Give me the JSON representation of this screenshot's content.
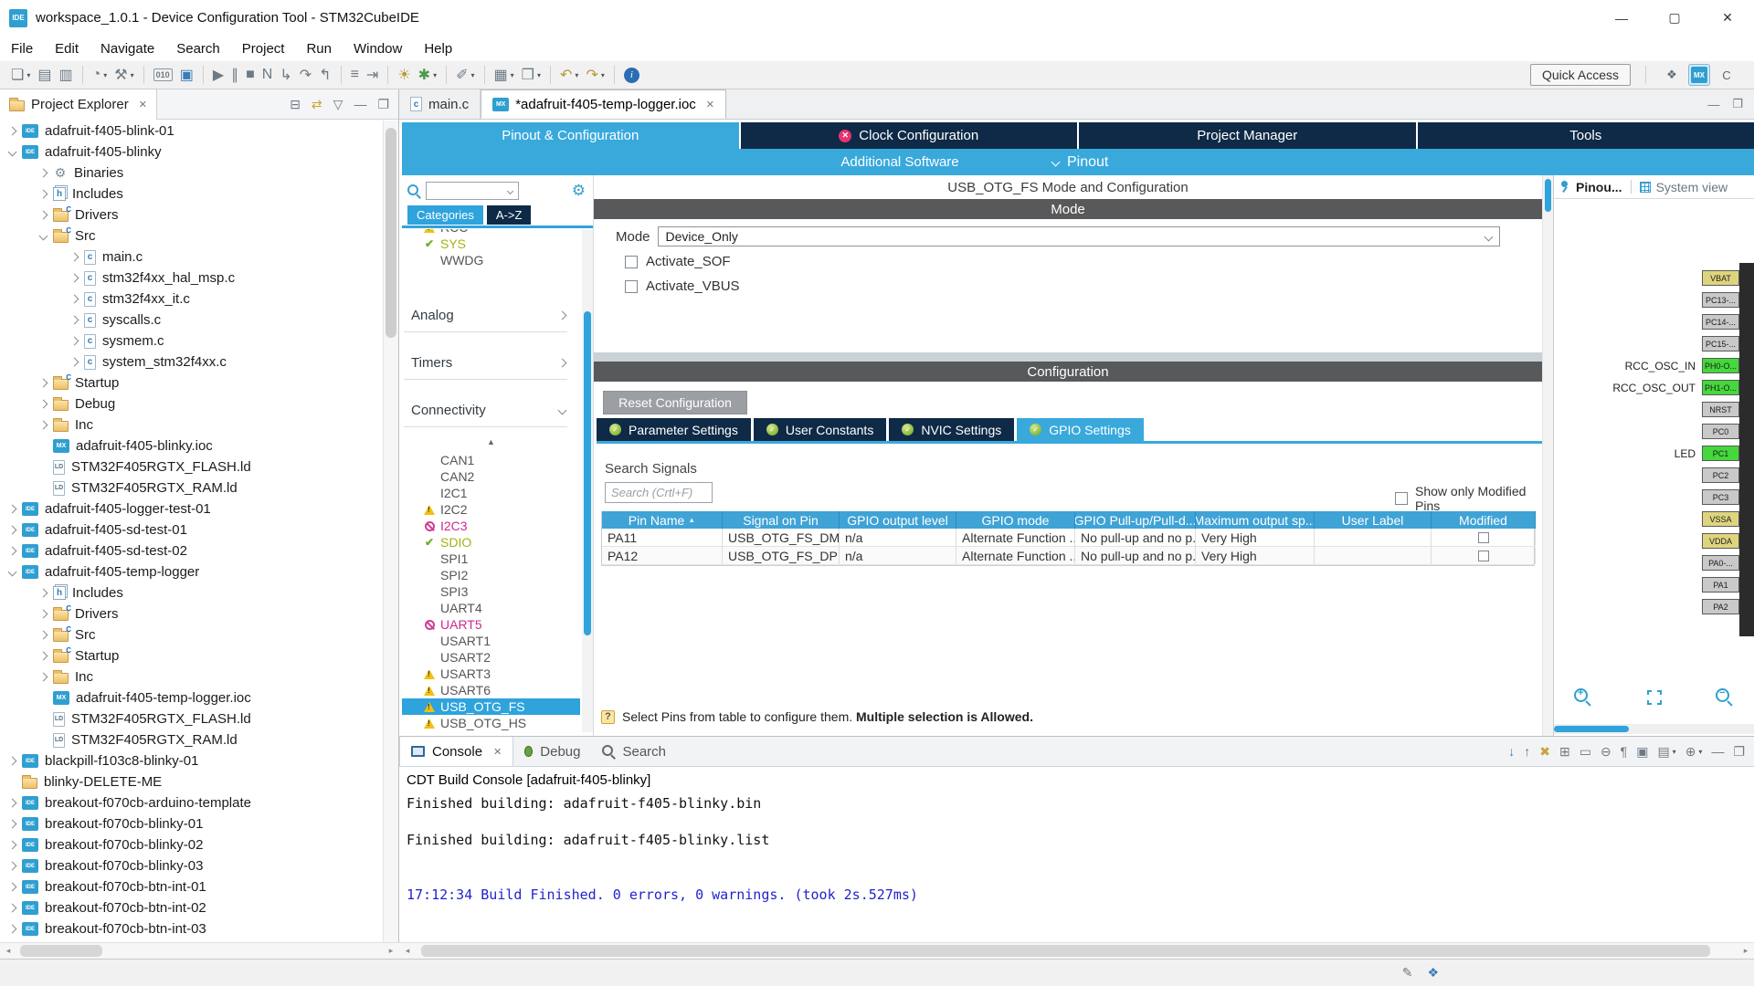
{
  "window": {
    "title": "workspace_1.0.1 - Device Configuration Tool - STM32CubeIDE",
    "app_badge": "IDE",
    "minimize": "—",
    "maximize": "▢",
    "close": "✕"
  },
  "menubar": [
    "File",
    "Edit",
    "Navigate",
    "Search",
    "Project",
    "Run",
    "Window",
    "Help"
  ],
  "toolbar": {
    "quick_access_label": "Quick Access",
    "items": [
      {
        "name": "new-icon",
        "glyph": "❏",
        "dropdown": true
      },
      {
        "name": "save-icon",
        "glyph": "▤"
      },
      {
        "name": "save-all-icon",
        "glyph": "▥"
      },
      {
        "sep": true
      },
      {
        "name": "launch-config-icon",
        "glyph": "◔",
        "dropdown": true
      },
      {
        "name": "build-icon",
        "glyph": "⚒",
        "dropdown": true
      },
      {
        "sep": true
      },
      {
        "name": "binary-icon",
        "glyph": "010",
        "text": true
      },
      {
        "name": "open-console-icon",
        "glyph": "▣",
        "color": "#3a7db8"
      },
      {
        "sep": true
      },
      {
        "name": "resume-icon",
        "glyph": "▶"
      },
      {
        "name": "suspend-icon",
        "glyph": "∥"
      },
      {
        "name": "terminate-icon",
        "glyph": "■"
      },
      {
        "name": "disconnect-icon",
        "glyph": "N"
      },
      {
        "name": "step-into-icon",
        "glyph": "↳"
      },
      {
        "name": "step-over-icon",
        "glyph": "↷"
      },
      {
        "name": "step-return-icon",
        "glyph": "↰"
      },
      {
        "sep": true
      },
      {
        "name": "instruction-stepping-icon",
        "glyph": "≡"
      },
      {
        "name": "skip-breakpoints-icon",
        "glyph": "⇥"
      },
      {
        "sep": true
      },
      {
        "name": "debug-icon",
        "glyph": "☀",
        "color": "#b49a35"
      },
      {
        "name": "run-icon",
        "glyph": "✱",
        "color": "#4c9a4c",
        "dropdown": true
      },
      {
        "sep": true
      },
      {
        "name": "profile-icon",
        "glyph": "✐",
        "dropdown": true
      },
      {
        "sep": true
      },
      {
        "name": "coverage-icon",
        "glyph": "▦",
        "dropdown": true
      },
      {
        "name": "new-cfile-icon",
        "glyph": "❒",
        "dropdown": true
      },
      {
        "sep": true
      },
      {
        "name": "back-icon",
        "glyph": "↶",
        "color": "#b49a35",
        "dropdown": true
      },
      {
        "name": "forward-icon",
        "glyph": "↷",
        "color": "#b49a35",
        "dropdown": true
      },
      {
        "sep": true
      },
      {
        "name": "info-icon",
        "glyph": "i",
        "info": true
      }
    ],
    "perspectives": [
      {
        "name": "open-perspective-icon",
        "glyph": "❖"
      },
      {
        "name": "device-configuration-perspective-icon",
        "glyph": "MX",
        "active": true
      },
      {
        "name": "c-cpp-perspective-icon",
        "glyph": "C"
      }
    ]
  },
  "project_explorer": {
    "title": "Project Explorer",
    "actions": [
      {
        "name": "collapse-all-icon",
        "glyph": "⊟"
      },
      {
        "name": "link-with-editor-icon",
        "glyph": "⇄",
        "color": "#c9a227"
      },
      {
        "name": "view-menu-icon",
        "glyph": "▽"
      },
      {
        "name": "minimize-view-icon",
        "glyph": "—"
      },
      {
        "name": "maximize-view-icon",
        "glyph": "❐"
      }
    ],
    "items": [
      {
        "label": "adafruit-f405-blink-01",
        "depth": 0,
        "icon": "ide",
        "expand": "closed"
      },
      {
        "label": "adafruit-f405-blinky",
        "depth": 0,
        "icon": "ide",
        "expand": "open"
      },
      {
        "label": "Binaries",
        "depth": 1,
        "icon": "bin",
        "expand": "closed"
      },
      {
        "label": "Includes",
        "depth": 1,
        "icon": "inc",
        "expand": "closed"
      },
      {
        "label": "Drivers",
        "depth": 1,
        "icon": "folderc",
        "expand": "closed"
      },
      {
        "label": "Src",
        "depth": 1,
        "icon": "folderc",
        "expand": "open"
      },
      {
        "label": "main.c",
        "depth": 2,
        "icon": "cfile",
        "expand": "closed"
      },
      {
        "label": "stm32f4xx_hal_msp.c",
        "depth": 2,
        "icon": "cfile",
        "expand": "closed"
      },
      {
        "label": "stm32f4xx_it.c",
        "depth": 2,
        "icon": "cfile",
        "expand": "closed"
      },
      {
        "label": "syscalls.c",
        "depth": 2,
        "icon": "cfile",
        "expand": "closed"
      },
      {
        "label": "sysmem.c",
        "depth": 2,
        "icon": "cfile",
        "expand": "closed"
      },
      {
        "label": "system_stm32f4xx.c",
        "depth": 2,
        "icon": "cfile",
        "expand": "closed"
      },
      {
        "label": "Startup",
        "depth": 1,
        "icon": "folderc",
        "expand": "closed"
      },
      {
        "label": "Debug",
        "depth": 1,
        "icon": "folder",
        "expand": "closed"
      },
      {
        "label": "Inc",
        "depth": 1,
        "icon": "folder",
        "expand": "closed"
      },
      {
        "label": "adafruit-f405-blinky.ioc",
        "depth": 1,
        "icon": "mx",
        "expand": null
      },
      {
        "label": "STM32F405RGTX_FLASH.ld",
        "depth": 1,
        "icon": "ld",
        "expand": null
      },
      {
        "label": "STM32F405RGTX_RAM.ld",
        "depth": 1,
        "icon": "ld",
        "expand": null
      },
      {
        "label": "adafruit-f405-logger-test-01",
        "depth": 0,
        "icon": "ide",
        "expand": "closed"
      },
      {
        "label": "adafruit-f405-sd-test-01",
        "depth": 0,
        "icon": "ide",
        "expand": "closed"
      },
      {
        "label": "adafruit-f405-sd-test-02",
        "depth": 0,
        "icon": "ide",
        "expand": "closed"
      },
      {
        "label": "adafruit-f405-temp-logger",
        "depth": 0,
        "icon": "ide",
        "expand": "open"
      },
      {
        "label": "Includes",
        "depth": 1,
        "icon": "inc",
        "expand": "closed"
      },
      {
        "label": "Drivers",
        "depth": 1,
        "icon": "folderc",
        "expand": "closed"
      },
      {
        "label": "Src",
        "depth": 1,
        "icon": "folderc",
        "expand": "closed"
      },
      {
        "label": "Startup",
        "depth": 1,
        "icon": "folderc",
        "expand": "closed"
      },
      {
        "label": "Inc",
        "depth": 1,
        "icon": "folder",
        "expand": "closed"
      },
      {
        "label": "adafruit-f405-temp-logger.ioc",
        "depth": 1,
        "icon": "mx",
        "expand": null
      },
      {
        "label": "STM32F405RGTX_FLASH.ld",
        "depth": 1,
        "icon": "ld",
        "expand": null
      },
      {
        "label": "STM32F405RGTX_RAM.ld",
        "depth": 1,
        "icon": "ld",
        "expand": null
      },
      {
        "label": "blackpill-f103c8-blinky-01",
        "depth": 0,
        "icon": "ide",
        "expand": "closed"
      },
      {
        "label": "blinky-DELETE-ME",
        "depth": 0,
        "icon": "folder",
        "expand": null
      },
      {
        "label": "breakout-f070cb-arduino-template",
        "depth": 0,
        "icon": "ide",
        "expand": "closed"
      },
      {
        "label": "breakout-f070cb-blinky-01",
        "depth": 0,
        "icon": "ide",
        "expand": "closed"
      },
      {
        "label": "breakout-f070cb-blinky-02",
        "depth": 0,
        "icon": "ide",
        "expand": "closed"
      },
      {
        "label": "breakout-f070cb-blinky-03",
        "depth": 0,
        "icon": "ide",
        "expand": "closed"
      },
      {
        "label": "breakout-f070cb-btn-int-01",
        "depth": 0,
        "icon": "ide",
        "expand": "closed"
      },
      {
        "label": "breakout-f070cb-btn-int-02",
        "depth": 0,
        "icon": "ide",
        "expand": "closed"
      },
      {
        "label": "breakout-f070cb-btn-int-03",
        "depth": 0,
        "icon": "ide",
        "expand": "closed"
      }
    ]
  },
  "editor": {
    "tabs": [
      {
        "label": "main.c",
        "icon": "cfile",
        "active": false
      },
      {
        "label": "*adafruit-f405-temp-logger.ioc",
        "icon": "mx",
        "active": true,
        "close": "✕"
      }
    ],
    "config_tabs": [
      {
        "label": "Pinout & Configuration",
        "active": true
      },
      {
        "label": "Clock Configuration",
        "error": true
      },
      {
        "label": "Project Manager"
      },
      {
        "label": "Tools"
      }
    ],
    "subnav": {
      "additional_software": "Additional Software",
      "pinout": "Pinout"
    }
  },
  "peripherals": {
    "tabs": [
      {
        "label": "Categories",
        "active": true
      },
      {
        "label": "A->Z"
      }
    ],
    "top_items": [
      {
        "label": "RCC",
        "icon": "warning",
        "partial": true
      },
      {
        "label": "SYS",
        "icon": "check",
        "style": "olive"
      },
      {
        "label": "WWDG"
      }
    ],
    "groups": [
      {
        "label": "Analog",
        "state": "collapsed"
      },
      {
        "label": "Timers",
        "state": "collapsed"
      },
      {
        "label": "Connectivity",
        "state": "expanded"
      }
    ],
    "connectivity_items": [
      {
        "label": "CAN1"
      },
      {
        "label": "CAN2"
      },
      {
        "label": "I2C1"
      },
      {
        "label": "I2C2",
        "icon": "warning"
      },
      {
        "label": "I2C3",
        "icon": "block",
        "style": "magenta"
      },
      {
        "label": "SDIO",
        "icon": "check",
        "style": "olive"
      },
      {
        "label": "SPI1"
      },
      {
        "label": "SPI2"
      },
      {
        "label": "SPI3"
      },
      {
        "label": "UART4"
      },
      {
        "label": "UART5",
        "icon": "block",
        "style": "magenta"
      },
      {
        "label": "USART1"
      },
      {
        "label": "USART2"
      },
      {
        "label": "USART3",
        "icon": "warning"
      },
      {
        "label": "USART6",
        "icon": "warning"
      },
      {
        "label": "USB_OTG_FS",
        "icon": "warning",
        "selected": true
      },
      {
        "label": "USB_OTG_HS",
        "icon": "warning"
      }
    ]
  },
  "mode_panel": {
    "title": "USB_OTG_FS Mode and Configuration",
    "section": "Mode",
    "mode_label": "Mode",
    "mode_value": "Device_Only",
    "checkboxes": [
      {
        "label": "Activate_SOF",
        "checked": false
      },
      {
        "label": "Activate_VBUS",
        "checked": false
      }
    ]
  },
  "configuration": {
    "section": "Configuration",
    "reset_button": "Reset Configuration",
    "tabs": [
      {
        "label": "Parameter Settings"
      },
      {
        "label": "User Constants"
      },
      {
        "label": "NVIC Settings"
      },
      {
        "label": "GPIO Settings",
        "active": true
      }
    ],
    "search_label": "Search Signals",
    "search_placeholder": "Search (Crtl+F)",
    "show_modified_label": "Show only Modified Pins",
    "table": {
      "columns": [
        "Pin Name",
        "Signal on Pin",
        "GPIO output level",
        "GPIO mode",
        "GPIO Pull-up/Pull-d...",
        "Maximum output sp...",
        "User Label",
        "Modified"
      ],
      "sorted_column": 0,
      "rows": [
        [
          "PA11",
          "USB_OTG_FS_DM",
          "n/a",
          "Alternate Function ...",
          "No pull-up and no p...",
          "Very High",
          "",
          false
        ],
        [
          "PA12",
          "USB_OTG_FS_DP",
          "n/a",
          "Alternate Function ...",
          "No pull-up and no p...",
          "Very High",
          "",
          false
        ]
      ]
    },
    "hint_text": "Select Pins from table to configure them. ",
    "hint_bold": "Multiple selection is Allowed."
  },
  "pinout_panel": {
    "tabs": [
      {
        "label": "Pinou...",
        "active": true
      },
      {
        "label": "System view"
      }
    ],
    "net_labels": [
      {
        "text": "RCC_OSC_IN",
        "pin_index": 4
      },
      {
        "text": "RCC_OSC_OUT",
        "pin_index": 5
      },
      {
        "text": "LED",
        "pin_index": 8
      }
    ],
    "pins": [
      {
        "label": "VBAT",
        "color": "#ded47e"
      },
      {
        "label": "PC13-...",
        "color": "#c9c9c9"
      },
      {
        "label": "PC14-...",
        "color": "#c9c9c9"
      },
      {
        "label": "PC15-...",
        "color": "#c9c9c9"
      },
      {
        "label": "PH0-O...",
        "color": "#45d83c"
      },
      {
        "label": "PH1-O...",
        "color": "#45d83c"
      },
      {
        "label": "NRST",
        "color": "#c9c9c9"
      },
      {
        "label": "PC0",
        "color": "#c9c9c9"
      },
      {
        "label": "PC1",
        "color": "#45d83c"
      },
      {
        "label": "PC2",
        "color": "#c9c9c9"
      },
      {
        "label": "PC3",
        "color": "#c9c9c9"
      },
      {
        "label": "VSSA",
        "color": "#ded47e"
      },
      {
        "label": "VDDA",
        "color": "#ded47e"
      },
      {
        "label": "PA0-...",
        "color": "#c9c9c9"
      },
      {
        "label": "PA1",
        "color": "#c9c9c9"
      },
      {
        "label": "PA2",
        "color": "#c9c9c9"
      }
    ]
  },
  "console": {
    "tabs": [
      {
        "label": "Console",
        "active": true,
        "icon": "monitor",
        "close": "✕"
      },
      {
        "label": "Debug",
        "icon": "bug"
      },
      {
        "label": "Search",
        "icon": "search"
      }
    ],
    "toolbar": [
      {
        "name": "next-annotation-icon",
        "glyph": "↓",
        "color": "#3a7db8"
      },
      {
        "name": "previous-annotation-icon",
        "glyph": "↑",
        "color": "#3a7db8"
      },
      {
        "name": "remove-launch-icon",
        "glyph": "✖",
        "color": "#caa23f"
      },
      {
        "name": "remove-all-launches-icon",
        "glyph": "⊞"
      },
      {
        "name": "clear-console-icon",
        "glyph": "▭"
      },
      {
        "name": "scroll-lock-icon",
        "glyph": "⊖"
      },
      {
        "name": "word-wrap-icon",
        "glyph": "¶"
      },
      {
        "name": "show-on-output-icon",
        "glyph": "▣"
      },
      {
        "name": "display-console-icon",
        "glyph": "▤",
        "dropdown": true
      },
      {
        "name": "open-console-icon",
        "glyph": "⊕",
        "dropdown": true
      },
      {
        "name": "minimize-view-icon",
        "glyph": "—"
      },
      {
        "name": "maximize-view-icon",
        "glyph": "❐"
      }
    ],
    "subtitle": "CDT Build Console [adafruit-f405-blinky]",
    "lines": [
      {
        "text": "Finished building: adafruit-f405-blinky.bin"
      },
      {
        "text": ""
      },
      {
        "text": "Finished building: adafruit-f405-blinky.list"
      },
      {
        "text": ""
      },
      {
        "text": ""
      },
      {
        "text": "17:12:34 Build Finished. 0 errors, 0 warnings. (took 2s.527ms)",
        "color": "#2323cd"
      }
    ]
  },
  "statusbar": {
    "icons": [
      {
        "name": "smart-insert-icon",
        "glyph": "✎"
      },
      {
        "name": "progress-icon",
        "glyph": "❖",
        "color": "#3a7db8"
      }
    ]
  }
}
